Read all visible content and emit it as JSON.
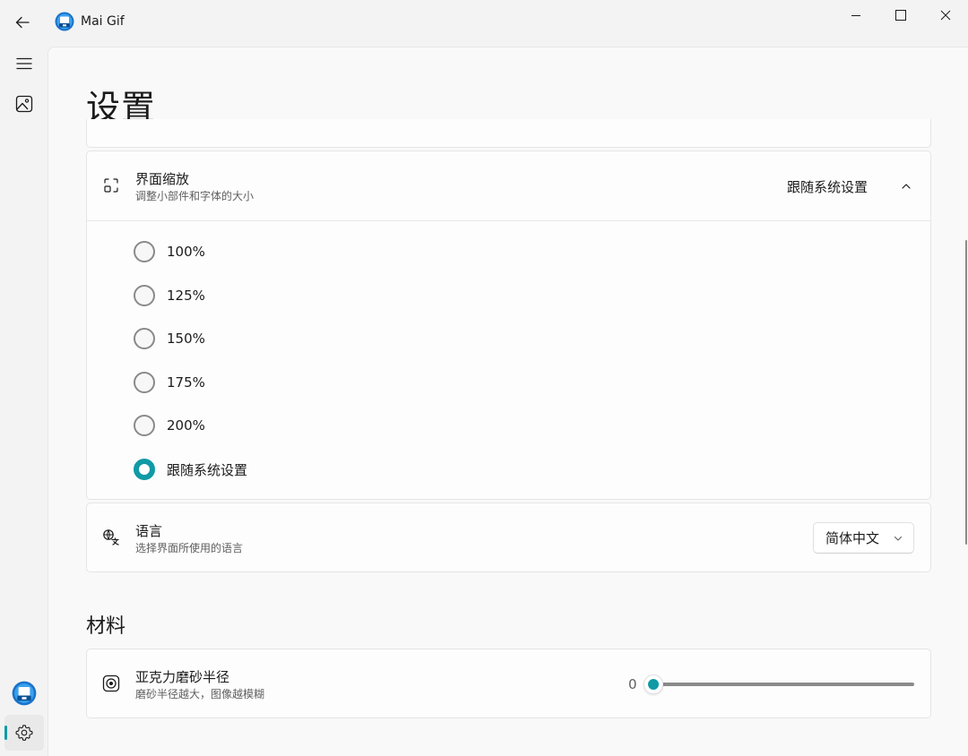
{
  "titlebar": {
    "app_title": "Mai Gif",
    "back_icon": "back-arrow-icon",
    "minimize_icon": "minimize-icon",
    "maximize_icon": "maximize-icon",
    "close_icon": "close-icon"
  },
  "nav": {
    "items": [
      {
        "name": "menu",
        "icon": "hamburger-icon"
      },
      {
        "name": "gallery",
        "icon": "image-icon"
      },
      {
        "name": "gif",
        "icon": "app-logo-icon"
      },
      {
        "name": "settings",
        "icon": "gear-icon",
        "selected": true
      }
    ]
  },
  "page": {
    "title": "设置"
  },
  "scale": {
    "title": "界面缩放",
    "description": "调整小部件和字体的大小",
    "current_value": "跟随系统设置",
    "expanded": true,
    "options": [
      {
        "label": "100%",
        "checked": false
      },
      {
        "label": "125%",
        "checked": false
      },
      {
        "label": "150%",
        "checked": false
      },
      {
        "label": "175%",
        "checked": false
      },
      {
        "label": "200%",
        "checked": false
      },
      {
        "label": "跟随系统设置",
        "checked": true
      }
    ]
  },
  "language": {
    "title": "语言",
    "description": "选择界面所使用的语言",
    "selected": "简体中文"
  },
  "material": {
    "section_title": "材料",
    "acrylic": {
      "title": "亚克力磨砂半径",
      "description": "磨砂半径越大，图像越模糊",
      "value": "0",
      "slider_fraction": 0
    }
  },
  "colors": {
    "accent": "#0f9aa5",
    "background": "#f3f3f3",
    "card": "#fdfdfd"
  }
}
